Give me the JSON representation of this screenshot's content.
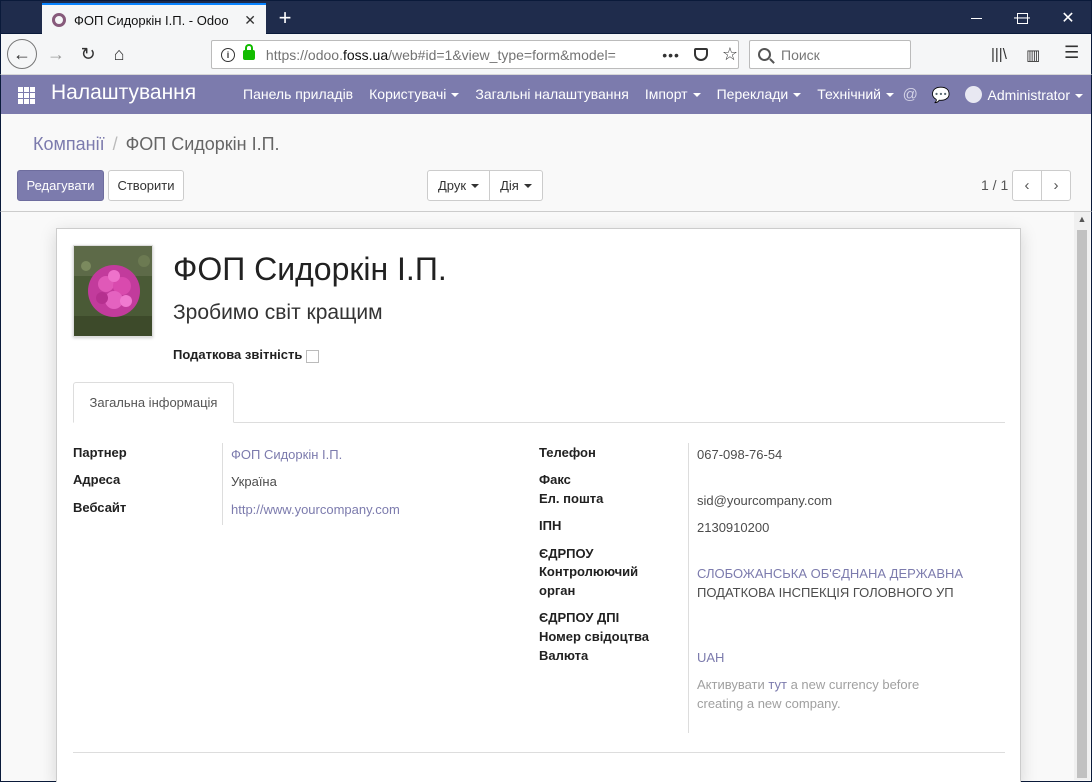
{
  "browser": {
    "tab_title": "ФОП Сидоркін І.П. - Odoo",
    "url_prefix": "https://odoo.",
    "url_domain": "foss.ua",
    "url_rest": "/web#id=1&view_type=form&model=",
    "search_placeholder": "Поиск"
  },
  "app": {
    "title": "Налаштування",
    "menu": [
      {
        "label": "Панель приладів",
        "dropdown": false
      },
      {
        "label": "Користувачі",
        "dropdown": true
      },
      {
        "label": "Загальні налаштування",
        "dropdown": false
      },
      {
        "label": "Імпорт",
        "dropdown": true
      },
      {
        "label": "Переклади",
        "dropdown": true
      },
      {
        "label": "Технічний",
        "dropdown": true
      }
    ],
    "user": "Administrator"
  },
  "breadcrumb": {
    "parent": "Компанії",
    "current": "ФОП Сидоркін І.П."
  },
  "buttons": {
    "edit": "Редагувати",
    "create": "Створити",
    "print": "Друк",
    "action": "Дія"
  },
  "pager": {
    "value": "1 / 1"
  },
  "form": {
    "name": "ФОП Сидоркін І.П.",
    "slogan": "Зробимо світ кращим",
    "tax_report_label": "Податкова звітність",
    "tax_report_checked": false,
    "tab": "Загальна інформація",
    "left": {
      "partner_label": "Партнер",
      "partner_value": "ФОП Сидоркін І.П.",
      "address_label": "Адреса",
      "address_value": "Україна",
      "website_label": "Вебсайт",
      "website_value": "http://www.yourcompany.com"
    },
    "right": {
      "phone_label": "Телефон",
      "phone_value": "067-098-76-54",
      "fax_label": "Факс",
      "email_label": "Ел. пошта",
      "email_value": "sid@yourcompany.com",
      "ipn_label": "ІПН",
      "ipn_value": "2130910200",
      "edrpou_label": "ЄДРПОУ",
      "control_label_1": "Контролюючий",
      "control_label_2": "орган",
      "control_value_1": "СЛОБОЖАНСЬКА ОБ'ЄДНАНА ДЕРЖАВНА",
      "control_value_2": "ПОДАТКОВА ІНСПЕКЦІЯ ГОЛОВНОГО УП",
      "edrpou_dpi_label": "ЄДРПОУ ДПІ",
      "cert_label": "Номер свідоцтва",
      "currency_label": "Валюта",
      "currency_value": "UAH",
      "currency_hint_1": "Активувати",
      "currency_hint_link": "тут",
      "currency_hint_2": "a new currency before",
      "currency_hint_3": "creating a new company."
    }
  }
}
